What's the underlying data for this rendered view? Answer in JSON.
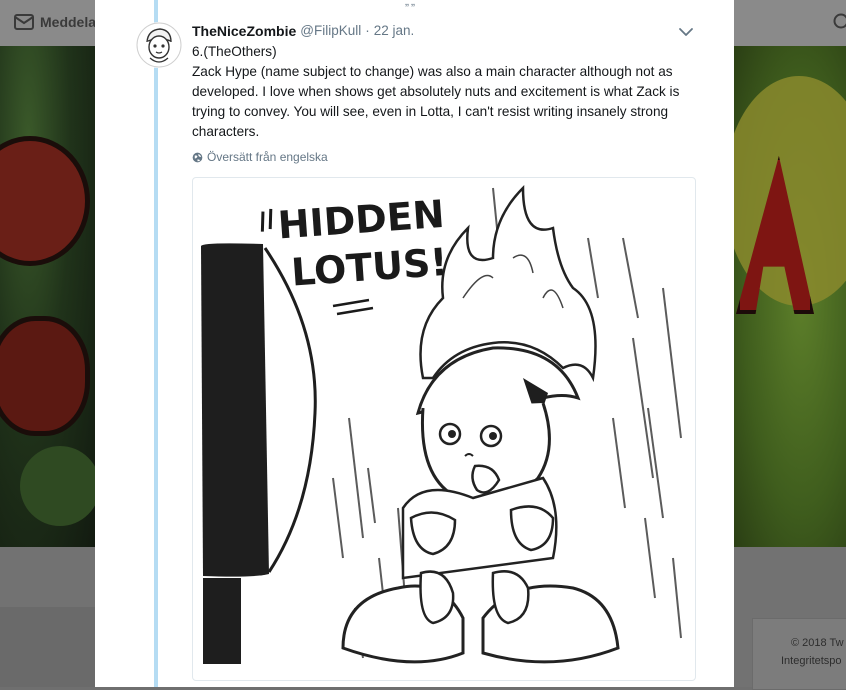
{
  "background": {
    "topbar": {
      "messages_label": "Meddelan"
    },
    "footer": {
      "copyright": "© 2018 Tw",
      "privacy": "Integritetspo"
    }
  },
  "tweet": {
    "display_name": "TheNiceZombie",
    "handle": "@FilipKull",
    "separator": "·",
    "date": "22 jan.",
    "lines": [
      "6.(TheOthers)",
      "Zack Hype (name subject to change) was also a main character although not as developed. I love when shows get absolutely nuts and excitement is what Zack is trying to convey. You will see, even in Lotta, I can't resist writing insanely strong characters."
    ],
    "translate_label": "Översätt från engelska",
    "image_text": {
      "line1": "HIDDEN",
      "line2": "LOTUS!"
    }
  },
  "colors": {
    "thread_line": "#b5dcf3",
    "text_primary": "#14171a",
    "text_secondary": "#657786",
    "overlay": "#6f6f6f"
  },
  "icons": [
    "envelope-icon",
    "search-icon",
    "chevron-down-icon",
    "globe-icon"
  ]
}
